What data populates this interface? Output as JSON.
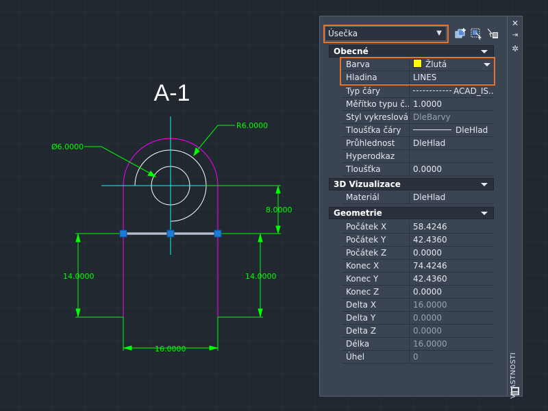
{
  "drawing": {
    "title": "A-1",
    "dimensions": {
      "radius": "R6.0000",
      "diameter": "Ø6.0000",
      "height_right": "8.0000",
      "left_height": "14.0000",
      "right_height": "14.0000",
      "bottom_width": "16.0000"
    }
  },
  "palette": {
    "object_type": "Úsečka",
    "side_title": "VLASTNOSTI",
    "sections": {
      "general": "Obecné",
      "vis3d": "3D Vizualizace",
      "geometry": "Geometrie"
    },
    "general": {
      "color": {
        "label": "Barva",
        "value": "Žlutá",
        "swatch": "#ffff00"
      },
      "layer": {
        "label": "Hladina",
        "value": "LINES"
      },
      "linetype": {
        "label": "Typ čáry",
        "value": "ACAD_IS..."
      },
      "ltscale": {
        "label": "Měřítko typu č...",
        "value": "1.0000"
      },
      "plotstyle": {
        "label": "Styl vykreslování",
        "value": "DleBarvy"
      },
      "lineweight": {
        "label": "Tloušťka čáry",
        "value": "DleHlad"
      },
      "transparency": {
        "label": "Průhlednost",
        "value": "DleHlad"
      },
      "hyperlink": {
        "label": "Hyperodkaz",
        "value": ""
      },
      "thickness": {
        "label": "Tloušťka",
        "value": "0.0000"
      }
    },
    "vis3d": {
      "material": {
        "label": "Materiál",
        "value": "DleHlad"
      }
    },
    "geometry": {
      "start_x": {
        "label": "Počátek X",
        "value": "58.4246"
      },
      "start_y": {
        "label": "Počátek Y",
        "value": "42.4360"
      },
      "start_z": {
        "label": "Počátek Z",
        "value": "0.0000"
      },
      "end_x": {
        "label": "Konec X",
        "value": "74.4246"
      },
      "end_y": {
        "label": "Konec Y",
        "value": "42.4360"
      },
      "end_z": {
        "label": "Konec Z",
        "value": "0.0000"
      },
      "delta_x": {
        "label": "Delta X",
        "value": "16.0000"
      },
      "delta_y": {
        "label": "Delta Y",
        "value": "0.0000"
      },
      "delta_z": {
        "label": "Delta Z",
        "value": "0.0000"
      },
      "length": {
        "label": "Délka",
        "value": "16.0000"
      },
      "angle": {
        "label": "Úhel",
        "value": "0"
      }
    }
  },
  "colors": {
    "dimension": "#00ff00",
    "outline": "#ff00ff",
    "centerline": "#00ffff",
    "highlight": "#e8742a",
    "grip": "#1e7bd6"
  }
}
